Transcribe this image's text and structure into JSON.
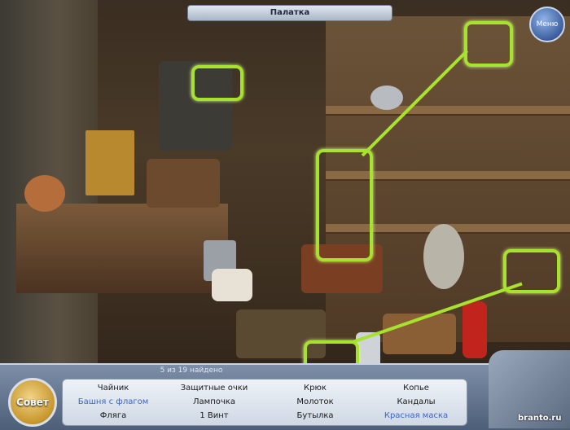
{
  "location_title": "Палатка",
  "menu_label": "Меню",
  "hint_label": "Совет",
  "found_counter": "5 из 19 найдено",
  "items": [
    {
      "label": "Чайник",
      "found": false
    },
    {
      "label": "Защитные очки",
      "found": false
    },
    {
      "label": "Крюк",
      "found": false
    },
    {
      "label": "Копье",
      "found": false
    },
    {
      "label": "Башня с флагом",
      "found": true
    },
    {
      "label": "Лампочка",
      "found": false
    },
    {
      "label": "Молоток",
      "found": false
    },
    {
      "label": "Кандалы",
      "found": false
    },
    {
      "label": "Фляга",
      "found": false
    },
    {
      "label": "1 Винт",
      "found": false
    },
    {
      "label": "Бутылка",
      "found": false
    },
    {
      "label": "Красная маска",
      "found": true
    }
  ],
  "watermark": "branto.ru",
  "colors": {
    "highlight": "#a6e22e",
    "found_item": "#3a66c8",
    "panel": "#5d6e89"
  }
}
